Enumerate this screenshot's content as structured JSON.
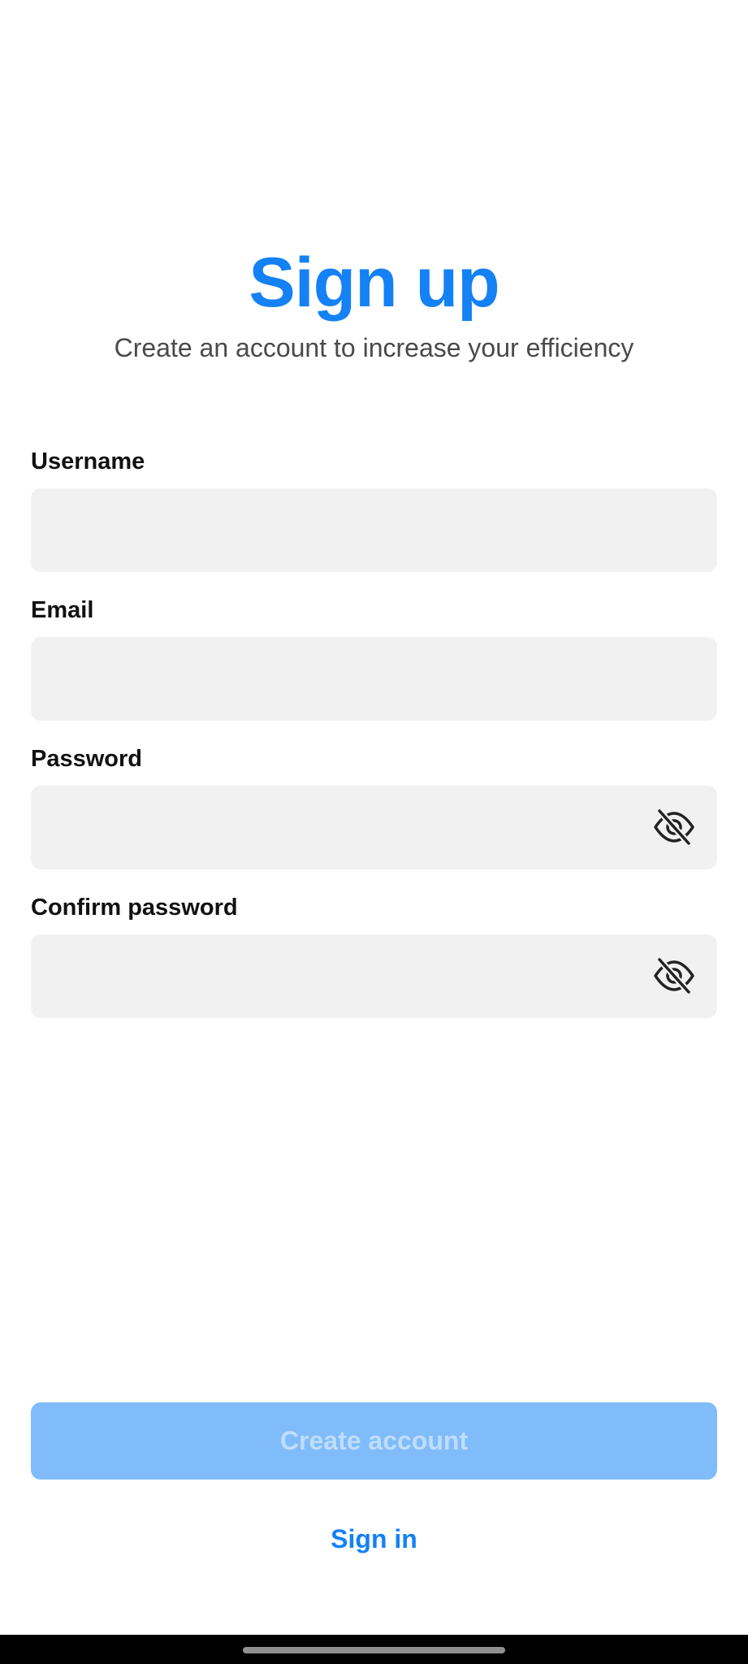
{
  "header": {
    "title": "Sign up",
    "subtitle": "Create an account to increase your efficiency"
  },
  "form": {
    "username": {
      "label": "Username",
      "value": "",
      "placeholder": ""
    },
    "email": {
      "label": "Email",
      "value": "",
      "placeholder": ""
    },
    "password": {
      "label": "Password",
      "value": "",
      "placeholder": "",
      "toggle_icon": "eye-off-icon"
    },
    "confirm_password": {
      "label": "Confirm password",
      "value": "",
      "placeholder": "",
      "toggle_icon": "eye-off-icon"
    }
  },
  "actions": {
    "create_account_label": "Create account",
    "create_account_enabled": false,
    "sign_in_label": "Sign in"
  },
  "colors": {
    "accent": "#1481f5",
    "button_disabled_bg": "#80bcfa",
    "field_bg": "#f1f1f1"
  }
}
